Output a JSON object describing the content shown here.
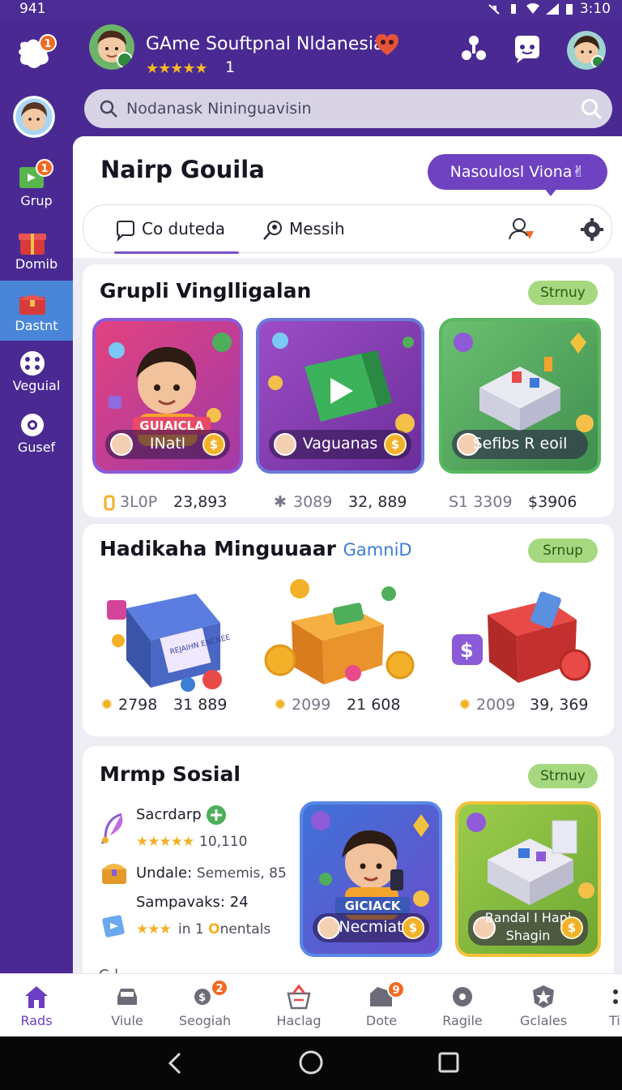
{
  "status_bar": {
    "time": "941",
    "clock": "3:10"
  },
  "header": {
    "logo_badge": "1",
    "profile_name": "GAme Souftpnal Nldanesia",
    "stars": "★★★★★",
    "rating_count": "1"
  },
  "search": {
    "placeholder": "Nodanask Nininguavisin"
  },
  "sidebar": {
    "items": [
      {
        "label": "Grup",
        "badge": "1",
        "icon": "flag-icon"
      },
      {
        "label": "Domib",
        "icon": "gift-box-icon"
      },
      {
        "label": "Dastnt",
        "icon": "chest-icon",
        "active": true
      },
      {
        "label": "Veguial",
        "icon": "grid-icon"
      },
      {
        "label": "Gusef",
        "icon": "settings-icon"
      }
    ]
  },
  "panel": {
    "title": "Nairp Gouila",
    "promo_button": "Nasoulosl Viona✌",
    "tabs": [
      {
        "label": "Co duteda",
        "icon": "chat-icon"
      },
      {
        "label": "Messih",
        "icon": "search-person-icon"
      }
    ]
  },
  "section_groups": {
    "title": "Grupli Vinglligalan",
    "pill": "Strnuy",
    "tiles": [
      {
        "name": "INatl",
        "banner": "GUIAICLA",
        "coin": "$"
      },
      {
        "name": "Vaguanas",
        "coin": "$"
      },
      {
        "name": "Sefibs R eoil",
        "coin": "$"
      }
    ],
    "stats": [
      {
        "a": "3L0P",
        "b": "23,893"
      },
      {
        "a": "3089",
        "b": "32, 889"
      },
      {
        "a": "S1 3309",
        "b": "$3906"
      }
    ]
  },
  "section_rewards": {
    "title": "Hadikaha Minguuaar",
    "title_accent": "GamniD",
    "pill": "Srnup",
    "box_label": "REJAIHN ENCNEE",
    "stats": [
      {
        "a": "2798",
        "b": "31 889"
      },
      {
        "a": "2099",
        "b": "21 608"
      },
      {
        "a": "2009",
        "b": "39, 369"
      }
    ]
  },
  "section_social": {
    "title": "Mrmp Sosial",
    "pill": "Strnuy",
    "rows": [
      {
        "label": "Sacrdarp",
        "stars": "★★★★★",
        "sub": "10,110"
      },
      {
        "label": "Undale:",
        "value": "Sememis, 85"
      },
      {
        "label": "Sampavaks: 24",
        "stars": "★★★",
        "sub_a": "in 1",
        "sub_b": "O",
        "sub_c": "nentals"
      }
    ],
    "tiles": [
      {
        "name": "Necmiat",
        "banner": "GICIACK",
        "coin": "$"
      },
      {
        "name": "Bandal I Hapi",
        "name2": "Shagin",
        "coin": "$"
      }
    ],
    "cut_text": "C-l"
  },
  "bottom_nav": [
    {
      "label": "Rads",
      "active": true
    },
    {
      "label": "Viule"
    },
    {
      "label": "Seogiah",
      "badge": "2"
    },
    {
      "label": "Haclag"
    },
    {
      "label": "Dote",
      "badge": "9"
    },
    {
      "label": "Ragile"
    },
    {
      "label": "Gclales"
    },
    {
      "label": "Ti"
    }
  ],
  "colors": {
    "brand_purple": "#4a2a92",
    "accent_purple": "#6e42c1",
    "active_blue": "#4a86d8",
    "pill_green": "#a6d97f",
    "coin_gold": "#f2b129",
    "notification_orange": "#f06a24"
  }
}
